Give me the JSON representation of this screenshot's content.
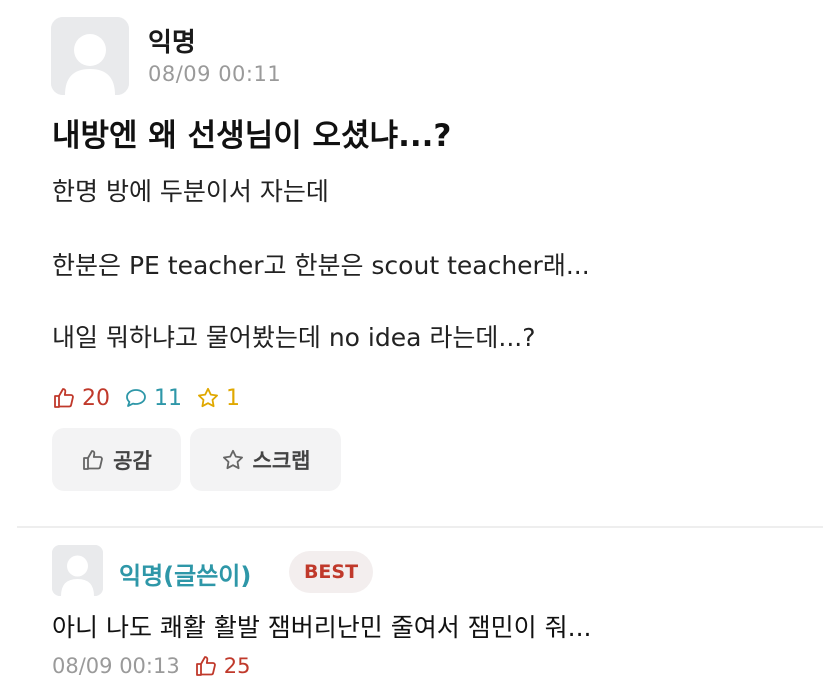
{
  "post": {
    "author": "익명",
    "time": "08/09 00:11",
    "title": "내방엔 왜 선생님이 오셨냐...?",
    "body": [
      "한명 방에 두분이서 자는데",
      "한분은 PE teacher고 한분은 scout teacher래...",
      "내일 뭐하냐고 물어봤는데 no idea 라는데...?"
    ],
    "stats": {
      "likes": "20",
      "comments": "11",
      "scraps": "1"
    },
    "buttons": {
      "like_label": "공감",
      "scrap_label": "스크랩"
    }
  },
  "comment": {
    "author": "익명(글쓴이)",
    "badge": "BEST",
    "text": "아니 나도 쾌활 활발 잼버리난민 줄여서 잼민이 줘...",
    "time": "08/09 00:13",
    "likes": "25"
  },
  "colors": {
    "like": "#c0392b",
    "comment": "#2e97a8",
    "scrap": "#e0a800",
    "muted": "#9a9a9a"
  }
}
